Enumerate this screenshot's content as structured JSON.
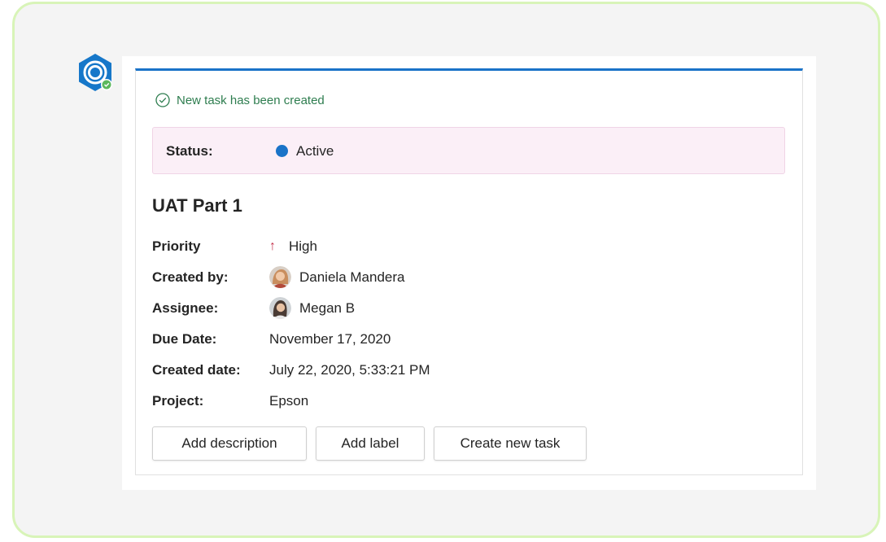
{
  "confirmation": {
    "text": "New task has been created",
    "icon": "check-circle-icon"
  },
  "status": {
    "label": "Status:",
    "value": "Active",
    "color": "#1a73c8"
  },
  "task": {
    "title": "UAT Part 1",
    "fields": {
      "priority": {
        "label": "Priority",
        "value": "High",
        "icon": "arrow-up-icon"
      },
      "created_by": {
        "label": "Created by:",
        "value": "Daniela Mandera"
      },
      "assignee": {
        "label": "Assignee:",
        "value": "Megan B"
      },
      "due_date": {
        "label": "Due Date:",
        "value": "November 17, 2020"
      },
      "created_date": {
        "label": "Created date:",
        "value": "July 22, 2020, 5:33:21 PM"
      },
      "project": {
        "label": "Project:",
        "value": "Epson"
      }
    }
  },
  "actions": {
    "add_description": "Add description",
    "add_label": "Add label",
    "create_new_task": "Create new task"
  },
  "colors": {
    "accent": "#1a73c8",
    "success": "#2e7d4f",
    "priority_high": "#c4314b",
    "status_bg": "#fbeff7",
    "frame_border": "#d8f4b8"
  }
}
